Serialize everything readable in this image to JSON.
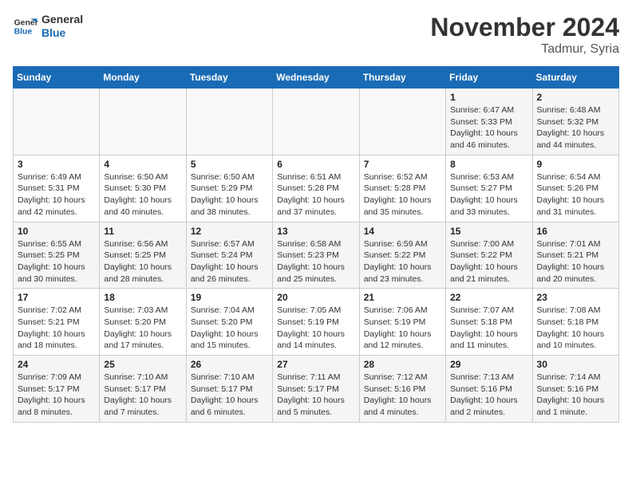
{
  "header": {
    "logo_line1": "General",
    "logo_line2": "Blue",
    "month": "November 2024",
    "location": "Tadmur, Syria"
  },
  "weekdays": [
    "Sunday",
    "Monday",
    "Tuesday",
    "Wednesday",
    "Thursday",
    "Friday",
    "Saturday"
  ],
  "weeks": [
    [
      {
        "day": "",
        "info": ""
      },
      {
        "day": "",
        "info": ""
      },
      {
        "day": "",
        "info": ""
      },
      {
        "day": "",
        "info": ""
      },
      {
        "day": "",
        "info": ""
      },
      {
        "day": "1",
        "info": "Sunrise: 6:47 AM\nSunset: 5:33 PM\nDaylight: 10 hours and 46 minutes."
      },
      {
        "day": "2",
        "info": "Sunrise: 6:48 AM\nSunset: 5:32 PM\nDaylight: 10 hours and 44 minutes."
      }
    ],
    [
      {
        "day": "3",
        "info": "Sunrise: 6:49 AM\nSunset: 5:31 PM\nDaylight: 10 hours and 42 minutes."
      },
      {
        "day": "4",
        "info": "Sunrise: 6:50 AM\nSunset: 5:30 PM\nDaylight: 10 hours and 40 minutes."
      },
      {
        "day": "5",
        "info": "Sunrise: 6:50 AM\nSunset: 5:29 PM\nDaylight: 10 hours and 38 minutes."
      },
      {
        "day": "6",
        "info": "Sunrise: 6:51 AM\nSunset: 5:28 PM\nDaylight: 10 hours and 37 minutes."
      },
      {
        "day": "7",
        "info": "Sunrise: 6:52 AM\nSunset: 5:28 PM\nDaylight: 10 hours and 35 minutes."
      },
      {
        "day": "8",
        "info": "Sunrise: 6:53 AM\nSunset: 5:27 PM\nDaylight: 10 hours and 33 minutes."
      },
      {
        "day": "9",
        "info": "Sunrise: 6:54 AM\nSunset: 5:26 PM\nDaylight: 10 hours and 31 minutes."
      }
    ],
    [
      {
        "day": "10",
        "info": "Sunrise: 6:55 AM\nSunset: 5:25 PM\nDaylight: 10 hours and 30 minutes."
      },
      {
        "day": "11",
        "info": "Sunrise: 6:56 AM\nSunset: 5:25 PM\nDaylight: 10 hours and 28 minutes."
      },
      {
        "day": "12",
        "info": "Sunrise: 6:57 AM\nSunset: 5:24 PM\nDaylight: 10 hours and 26 minutes."
      },
      {
        "day": "13",
        "info": "Sunrise: 6:58 AM\nSunset: 5:23 PM\nDaylight: 10 hours and 25 minutes."
      },
      {
        "day": "14",
        "info": "Sunrise: 6:59 AM\nSunset: 5:22 PM\nDaylight: 10 hours and 23 minutes."
      },
      {
        "day": "15",
        "info": "Sunrise: 7:00 AM\nSunset: 5:22 PM\nDaylight: 10 hours and 21 minutes."
      },
      {
        "day": "16",
        "info": "Sunrise: 7:01 AM\nSunset: 5:21 PM\nDaylight: 10 hours and 20 minutes."
      }
    ],
    [
      {
        "day": "17",
        "info": "Sunrise: 7:02 AM\nSunset: 5:21 PM\nDaylight: 10 hours and 18 minutes."
      },
      {
        "day": "18",
        "info": "Sunrise: 7:03 AM\nSunset: 5:20 PM\nDaylight: 10 hours and 17 minutes."
      },
      {
        "day": "19",
        "info": "Sunrise: 7:04 AM\nSunset: 5:20 PM\nDaylight: 10 hours and 15 minutes."
      },
      {
        "day": "20",
        "info": "Sunrise: 7:05 AM\nSunset: 5:19 PM\nDaylight: 10 hours and 14 minutes."
      },
      {
        "day": "21",
        "info": "Sunrise: 7:06 AM\nSunset: 5:19 PM\nDaylight: 10 hours and 12 minutes."
      },
      {
        "day": "22",
        "info": "Sunrise: 7:07 AM\nSunset: 5:18 PM\nDaylight: 10 hours and 11 minutes."
      },
      {
        "day": "23",
        "info": "Sunrise: 7:08 AM\nSunset: 5:18 PM\nDaylight: 10 hours and 10 minutes."
      }
    ],
    [
      {
        "day": "24",
        "info": "Sunrise: 7:09 AM\nSunset: 5:17 PM\nDaylight: 10 hours and 8 minutes."
      },
      {
        "day": "25",
        "info": "Sunrise: 7:10 AM\nSunset: 5:17 PM\nDaylight: 10 hours and 7 minutes."
      },
      {
        "day": "26",
        "info": "Sunrise: 7:10 AM\nSunset: 5:17 PM\nDaylight: 10 hours and 6 minutes."
      },
      {
        "day": "27",
        "info": "Sunrise: 7:11 AM\nSunset: 5:17 PM\nDaylight: 10 hours and 5 minutes."
      },
      {
        "day": "28",
        "info": "Sunrise: 7:12 AM\nSunset: 5:16 PM\nDaylight: 10 hours and 4 minutes."
      },
      {
        "day": "29",
        "info": "Sunrise: 7:13 AM\nSunset: 5:16 PM\nDaylight: 10 hours and 2 minutes."
      },
      {
        "day": "30",
        "info": "Sunrise: 7:14 AM\nSunset: 5:16 PM\nDaylight: 10 hours and 1 minute."
      }
    ]
  ]
}
